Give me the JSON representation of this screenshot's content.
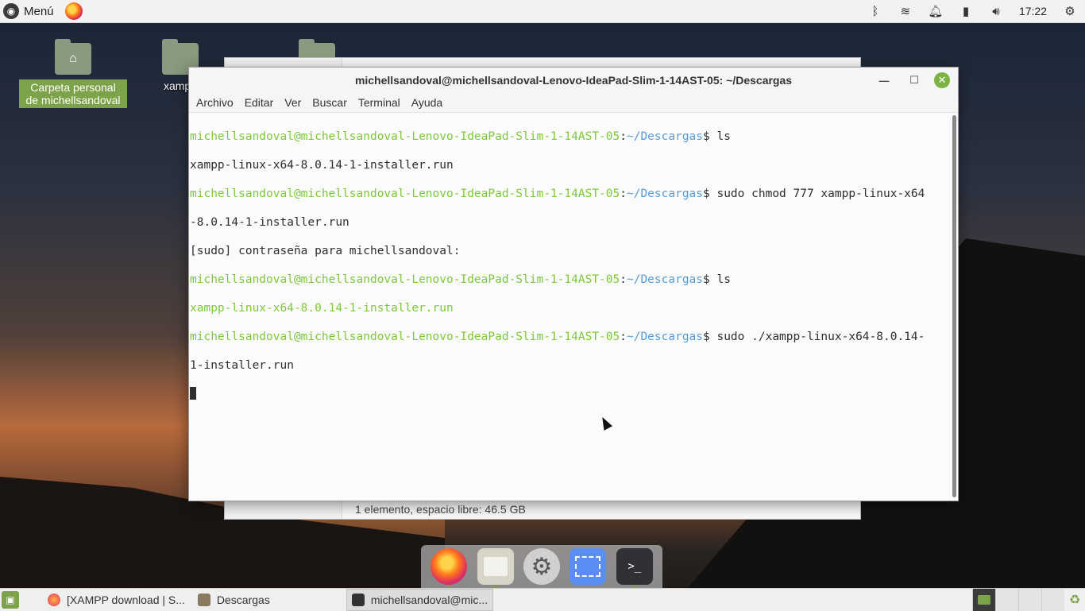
{
  "top_panel": {
    "menu_label": "Menú",
    "clock": "17:22",
    "tray_icons": [
      "bluetooth-icon",
      "wifi-icon",
      "bell-icon",
      "battery-icon",
      "volume-icon",
      "gear-icon"
    ]
  },
  "desktop": {
    "icons": [
      {
        "label": "Carpeta personal de michellsandoval"
      },
      {
        "label": "xampp"
      }
    ]
  },
  "file_manager": {
    "status": "1 elemento, espacio libre: 46.5 GB"
  },
  "terminal": {
    "title": "michellsandoval@michellsandoval-Lenovo-IdeaPad-Slim-1-14AST-05: ~/Descargas",
    "menu": [
      "Archivo",
      "Editar",
      "Ver",
      "Buscar",
      "Terminal",
      "Ayuda"
    ],
    "prompt_user": "michellsandoval@michellsandoval-Lenovo-IdeaPad-Slim-1-14AST-05",
    "prompt_path": "~/Descargas",
    "lines": {
      "l1_cmd": "$ ls",
      "l2": "xampp-linux-x64-8.0.14-1-installer.run",
      "l3_cmd": "$ sudo chmod 777 xampp-linux-x64",
      "l4": "-8.0.14-1-installer.run",
      "l5": "[sudo] contraseña para michellsandoval:",
      "l6_cmd": "$ ls",
      "l7": "xampp-linux-x64-8.0.14-1-installer.run",
      "l8_cmd": "$ sudo ./xampp-linux-x64-8.0.14-",
      "l9": "1-installer.run"
    }
  },
  "dock": {
    "items": [
      "firefox-icon",
      "files-icon",
      "settings-icon",
      "screenshot-icon",
      "terminal-icon"
    ]
  },
  "taskbar": {
    "tasks": [
      {
        "label": "[XAMPP download | S..."
      },
      {
        "label": "Descargas"
      },
      {
        "label": "michellsandoval@mic..."
      }
    ]
  },
  "colors": {
    "accent": "#7da34a",
    "prompt_user": "#7ec93b",
    "prompt_path": "#5a9ad6"
  }
}
